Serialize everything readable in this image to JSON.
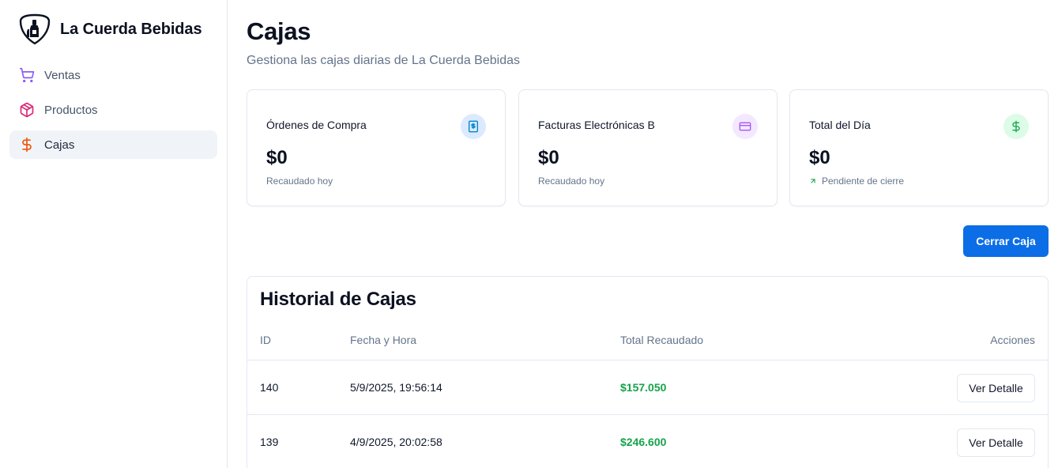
{
  "brand": {
    "name": "La Cuerda Bebidas"
  },
  "sidebar": {
    "items": [
      {
        "label": "Ventas",
        "icon": "shopping-cart-icon",
        "color": "#8b5cf6",
        "active": false
      },
      {
        "label": "Productos",
        "icon": "package-icon",
        "color": "#db2777",
        "active": false
      },
      {
        "label": "Cajas",
        "icon": "dollar-sign-icon",
        "color": "#ea580c",
        "active": true
      }
    ]
  },
  "header": {
    "title": "Cajas",
    "subtitle": "Gestiona las cajas diarias de La Cuerda Bebidas"
  },
  "cards": [
    {
      "title": "Órdenes de Compra",
      "value": "$0",
      "note": "Recaudado hoy",
      "icon": "receipt-dollar-icon",
      "icon_color": "#0284c7",
      "icon_bg": "#dbeafe"
    },
    {
      "title": "Facturas Electrónicas B",
      "value": "$0",
      "note": "Recaudado hoy",
      "icon": "credit-card-icon",
      "icon_color": "#a855f7",
      "icon_bg": "#f3e8ff"
    },
    {
      "title": "Total del Día",
      "value": "$0",
      "note": "Pendiente de cierre",
      "icon": "dollar-sign-icon",
      "icon_color": "#16a34a",
      "icon_bg": "#dcfce7",
      "trend_icon": "arrow-up-right-icon"
    }
  ],
  "actions": {
    "close_register": "Cerrar Caja"
  },
  "history": {
    "title": "Historial de Cajas",
    "columns": [
      "ID",
      "Fecha y Hora",
      "Total Recaudado",
      "Acciones"
    ],
    "rows": [
      {
        "id": "140",
        "datetime": "5/9/2025, 19:56:14",
        "total": "$157.050",
        "action": "Ver Detalle"
      },
      {
        "id": "139",
        "datetime": "4/9/2025, 20:02:58",
        "total": "$246.600",
        "action": "Ver Detalle"
      }
    ]
  },
  "colors": {
    "primary": "#0b6ee6",
    "money": "#16a34a",
    "active_nav_bg": "#f0f4f8"
  }
}
